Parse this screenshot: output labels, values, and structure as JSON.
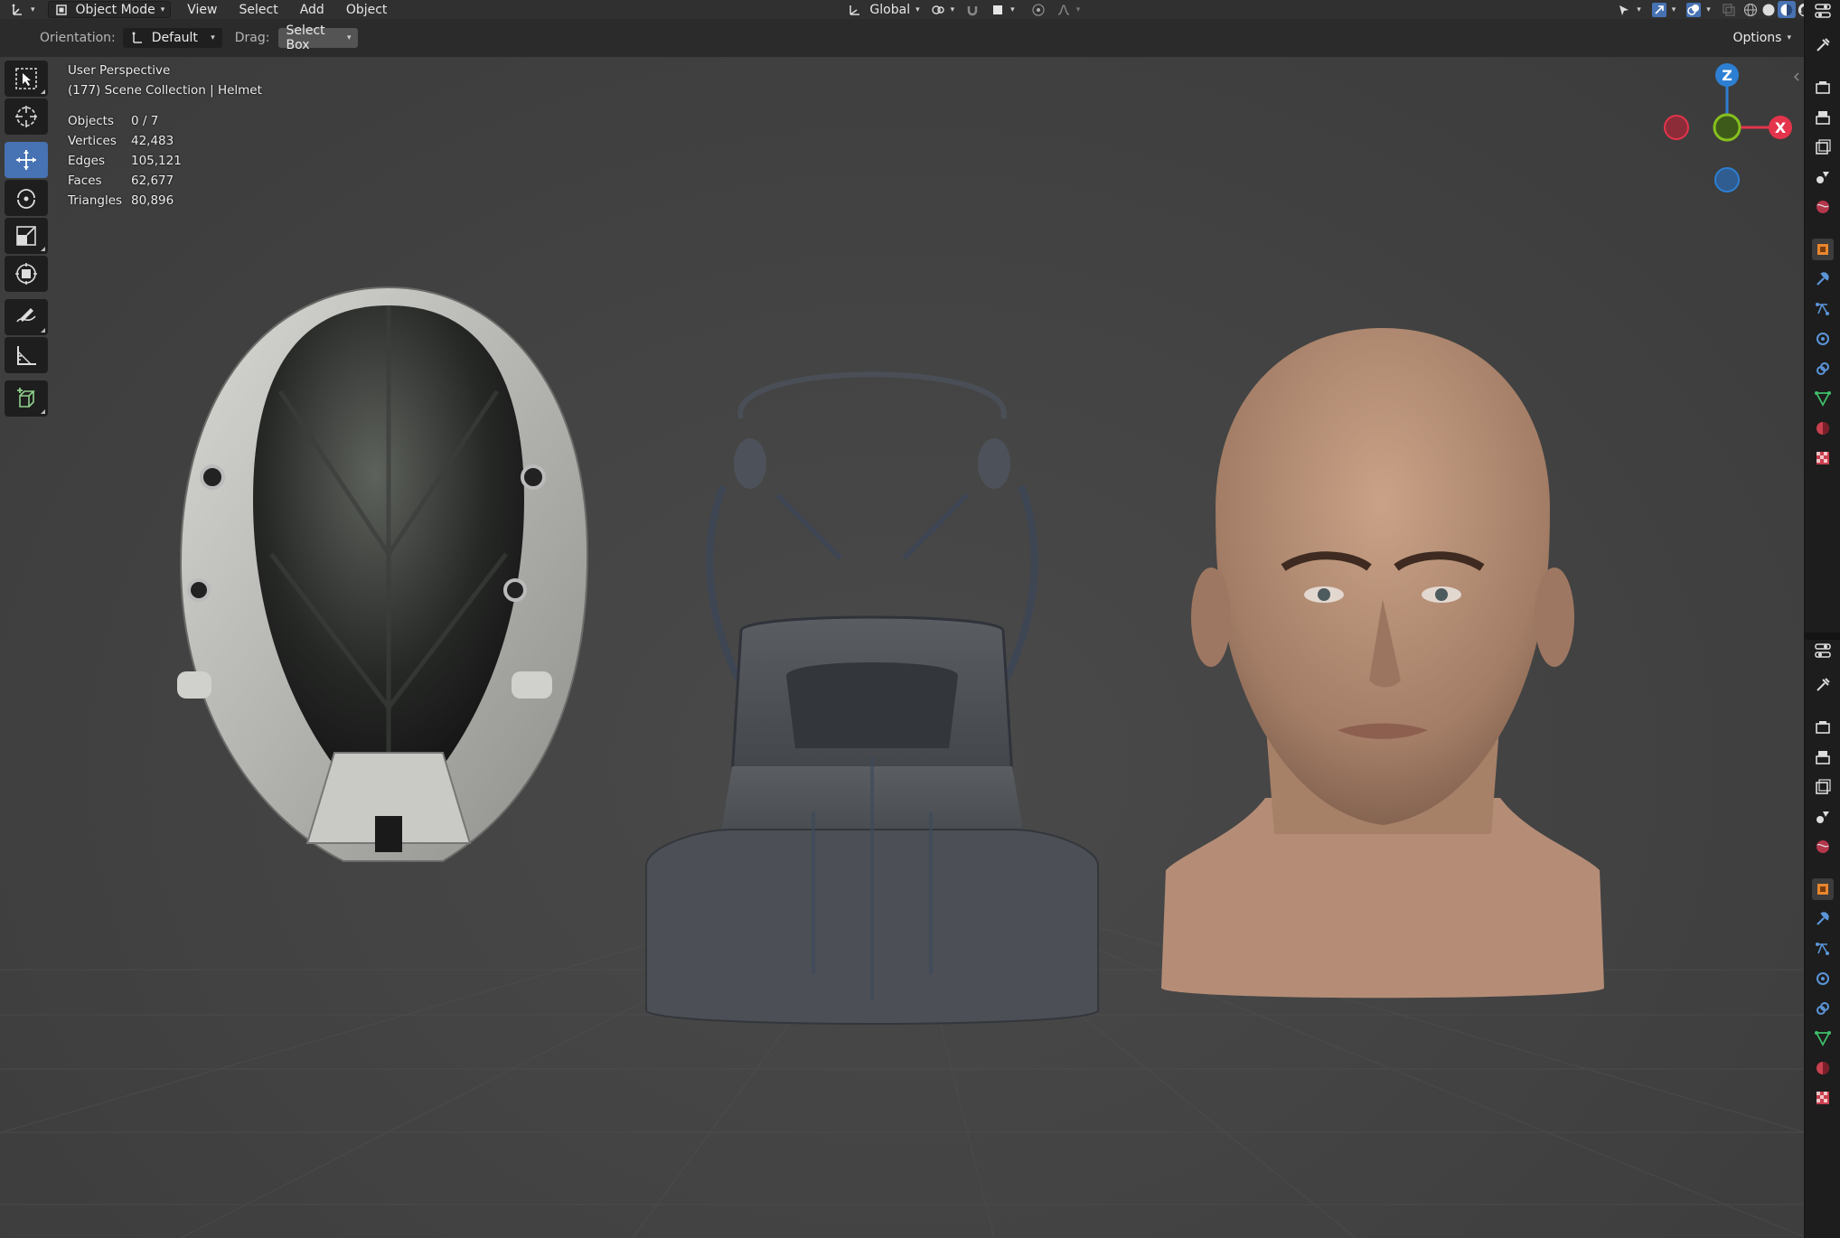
{
  "header": {
    "mode": "Object Mode",
    "menus": [
      "View",
      "Select",
      "Add",
      "Object"
    ],
    "transform_orientation": "Global"
  },
  "tool_settings": {
    "orientation_label": "Orientation:",
    "orientation_value": "Default",
    "drag_label": "Drag:",
    "drag_value": "Select Box",
    "options_label": "Options"
  },
  "viewport": {
    "view_name": "User Perspective",
    "collection": "(177) Scene Collection | Helmet",
    "stats": [
      {
        "label": "Objects",
        "value": "0 / 7"
      },
      {
        "label": "Vertices",
        "value": "42,483"
      },
      {
        "label": "Edges",
        "value": "105,121"
      },
      {
        "label": "Faces",
        "value": "62,677"
      },
      {
        "label": "Triangles",
        "value": "80,896"
      }
    ],
    "gizmo": {
      "z_label": "Z",
      "x_label": "X",
      "colors": {
        "x": "#e4344b",
        "y": "#86c01e",
        "z": "#2d7fd3"
      }
    }
  },
  "toolbar": {
    "tools": [
      "select-box",
      "cursor",
      "move",
      "rotate",
      "scale",
      "transform",
      "annotate",
      "measure",
      "add-cube"
    ],
    "active": "move",
    "accent": "#4772b3"
  },
  "properties_tabs": [
    "tool",
    "render",
    "output",
    "view-layer",
    "scene",
    "world",
    "object",
    "modifiers",
    "particles",
    "physics",
    "constraints",
    "data",
    "material",
    "texture"
  ]
}
